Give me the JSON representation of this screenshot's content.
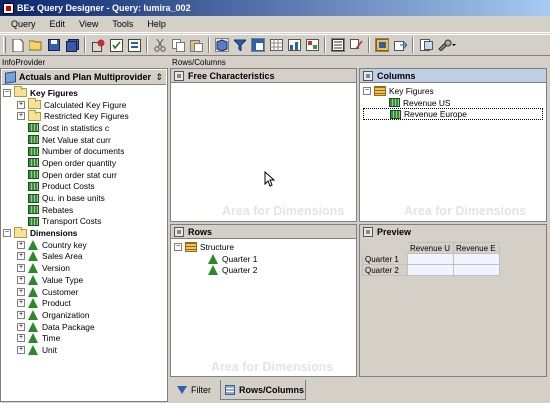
{
  "window": {
    "title": "BEx Query Designer - Query: lumira_002"
  },
  "menu": [
    "Query",
    "Edit",
    "View",
    "Tools",
    "Help"
  ],
  "toolbar": {
    "icons": [
      "new-icon",
      "open-icon",
      "save-icon",
      "save-all-icon",
      "execute-icon",
      "check-icon",
      "properties-icon",
      "cut-icon",
      "copy-icon",
      "paste-icon",
      "infoprovider-icon",
      "filter-icon",
      "rows-columns-icon",
      "cells-icon",
      "conditions-icon",
      "exceptions-icon",
      "sap-protocol-icon",
      "tasks-icon",
      "documents-icon",
      "where-used-icon",
      "exit-icon",
      "settings-icon"
    ]
  },
  "infoprovider": {
    "header": "InfoProvider",
    "title": "Actuals and Plan Multiprovider",
    "key_figures_label": "Key Figures",
    "key_figures": [
      {
        "label": "Calculated Key Figure",
        "type": "folder",
        "expand": true
      },
      {
        "label": "Restricted Key Figures",
        "type": "folder",
        "expand": true
      },
      {
        "label": "Cost in statistics c",
        "type": "kf"
      },
      {
        "label": "Net Value stat curr",
        "type": "kf"
      },
      {
        "label": "Number of documents",
        "type": "kf"
      },
      {
        "label": "Open order quantity",
        "type": "kf"
      },
      {
        "label": "Open order stat curr",
        "type": "kf"
      },
      {
        "label": "Product Costs",
        "type": "kf"
      },
      {
        "label": "Qu. in base units",
        "type": "kf"
      },
      {
        "label": "Rebates",
        "type": "kf"
      },
      {
        "label": "Transport Costs",
        "type": "kf"
      }
    ],
    "dimensions_label": "Dimensions",
    "dimensions": [
      "Country key",
      "Sales Area",
      "Version",
      "Value Type",
      "Customer",
      "Product",
      "Organization",
      "Data Package",
      "Time",
      "Unit"
    ]
  },
  "rows_columns_header": "Rows/Columns",
  "free_characteristics": {
    "title": "Free Characteristics",
    "watermark": "Area for Dimensions"
  },
  "columns": {
    "title": "Columns",
    "root": "Key Figures",
    "items": [
      "Revenue US",
      "Revenue Europe"
    ],
    "watermark": "Area for Dimensions"
  },
  "rows": {
    "title": "Rows",
    "root": "Structure",
    "items": [
      "Quarter 1",
      "Quarter 2"
    ],
    "watermark": "Area for Dimensions"
  },
  "preview": {
    "title": "Preview",
    "col_headers": [
      "Revenue U",
      "Revenue E"
    ],
    "row_headers": [
      "Quarter 1",
      "Quarter 2"
    ]
  },
  "tabs": [
    {
      "label": "Filter",
      "active": false
    },
    {
      "label": "Rows/Columns",
      "active": true
    }
  ]
}
